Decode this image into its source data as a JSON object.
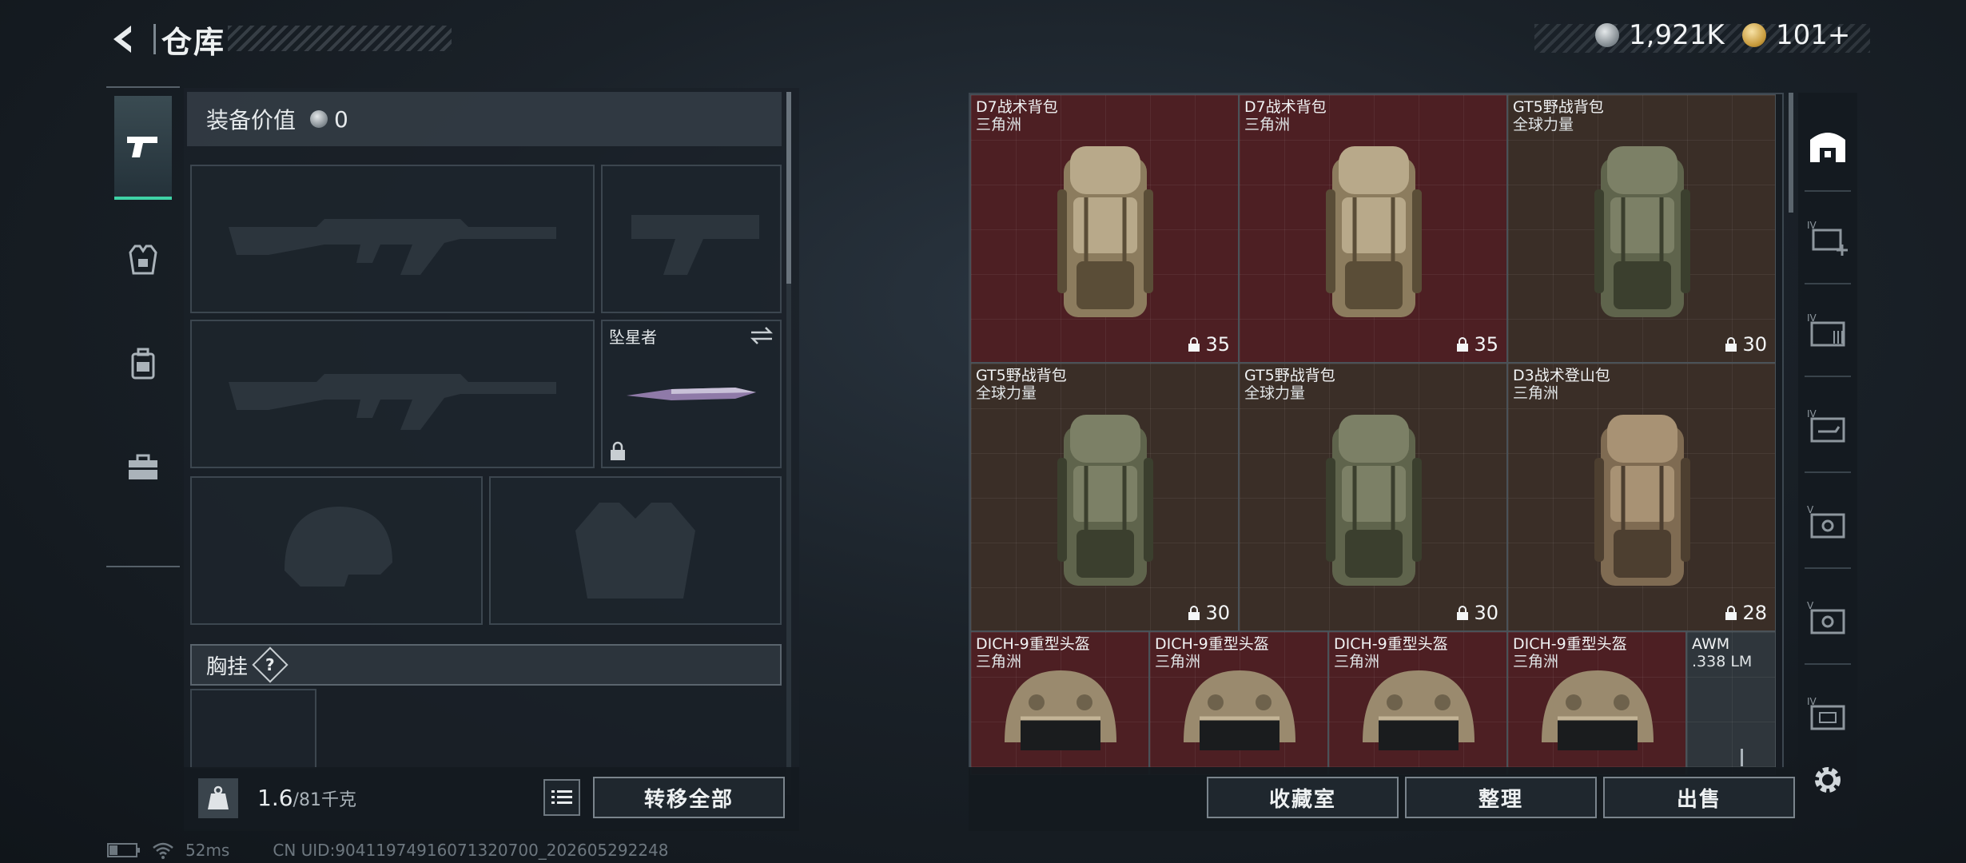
{
  "header": {
    "title": "仓库",
    "currencies": [
      {
        "icon": "silver-coin-icon",
        "value": "1,921K"
      },
      {
        "icon": "gold-coin-icon",
        "value": "101+"
      }
    ]
  },
  "loadout": {
    "value_label": "装备价值",
    "value": "0",
    "melee_slot": {
      "name": "坠星者"
    },
    "chest_label": "胸挂",
    "chest_help": "?",
    "weight": "1.6",
    "weight_max": "/81千克",
    "transfer_all": "转移全部"
  },
  "stash": {
    "items": [
      {
        "name": "D7战术背包",
        "sub": "三角洲",
        "cap": "35",
        "color": "red"
      },
      {
        "name": "D7战术背包",
        "sub": "三角洲",
        "cap": "35",
        "color": "red"
      },
      {
        "name": "GT5野战背包",
        "sub": "全球力量",
        "cap": "30",
        "color": "brown"
      },
      {
        "name": "GT5野战背包",
        "sub": "全球力量",
        "cap": "30",
        "color": "brown"
      },
      {
        "name": "GT5野战背包",
        "sub": "全球力量",
        "cap": "30",
        "color": "brown"
      },
      {
        "name": "D3战术登山包",
        "sub": "三角洲",
        "cap": "28",
        "color": "brown"
      },
      {
        "name": "DICH-9重型头盔",
        "sub": "三角洲",
        "color": "red"
      },
      {
        "name": "DICH-9重型头盔",
        "sub": "三角洲",
        "color": "red"
      },
      {
        "name": "DICH-9重型头盔",
        "sub": "三角洲",
        "color": "red"
      },
      {
        "name": "DICH-9重型头盔",
        "sub": "三角洲",
        "color": "red"
      },
      {
        "name": "AWM",
        "sub": ".338 LM",
        "color": "grey"
      }
    ],
    "buttons": {
      "collection": "收藏室",
      "sort": "整理",
      "sell": "出售"
    }
  },
  "status": {
    "ping": "52ms",
    "uid": "CN UID:9041197491607132070​0_202605292248"
  }
}
